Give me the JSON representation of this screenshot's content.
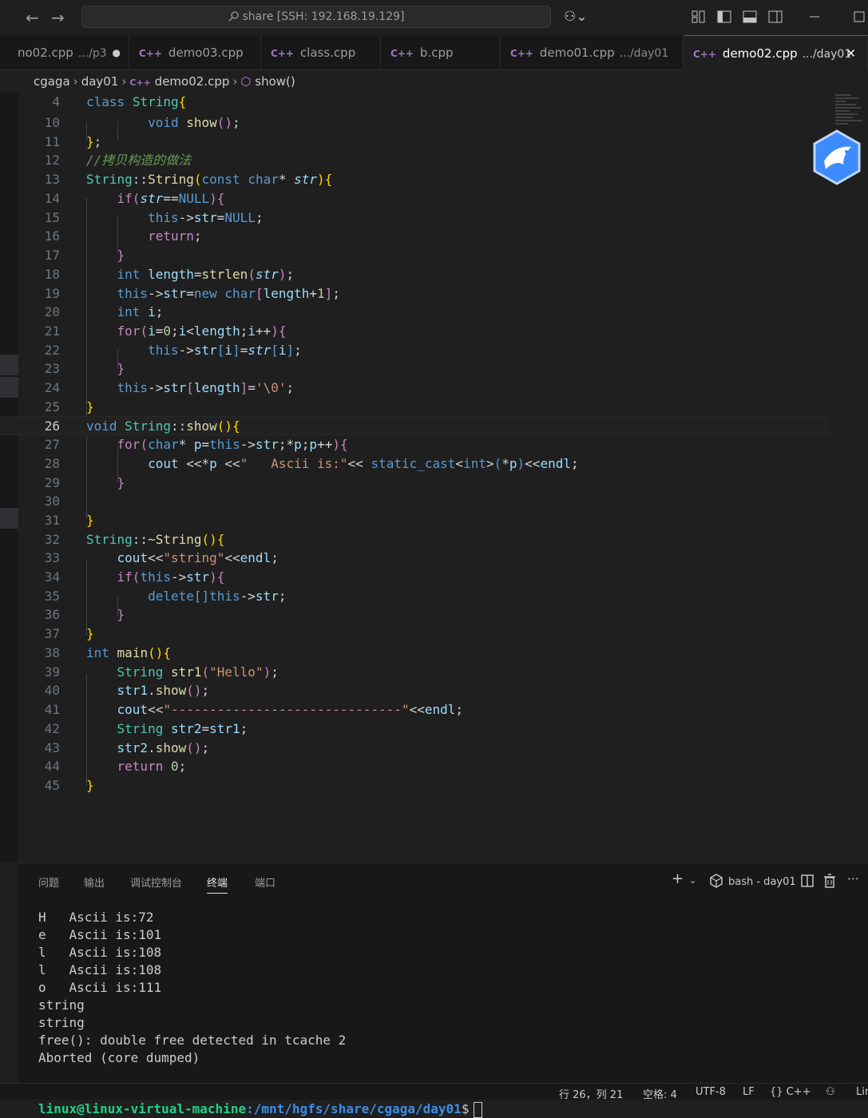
{
  "titlebar": {
    "back": "←",
    "forward": "→",
    "search": "share [SSH: 192.168.19.129]",
    "copilot": "⚇⌄"
  },
  "tabs": [
    {
      "name": "no02.cpp",
      "dir": ".../p3",
      "modified": "●"
    },
    {
      "name": "demo03.cpp",
      "dir": ""
    },
    {
      "name": "class.cpp",
      "dir": ""
    },
    {
      "name": "b.cpp",
      "dir": ""
    },
    {
      "name": "demo01.cpp",
      "dir": ".../day01"
    },
    {
      "name": "demo02.cpp",
      "dir": ".../day01",
      "close": "✕"
    }
  ],
  "breadcrumb": {
    "parts": [
      "cgaga",
      "day01",
      "demo02.cpp",
      "show()"
    ]
  },
  "editor": {
    "line_numbers": [
      "4",
      "10",
      "11",
      "12",
      "13",
      "14",
      "15",
      "16",
      "17",
      "18",
      "19",
      "20",
      "21",
      "22",
      "23",
      "24",
      "25",
      "26",
      "27",
      "28",
      "29",
      "30",
      "31",
      "32",
      "33",
      "34",
      "35",
      "36",
      "37",
      "38",
      "39",
      "40",
      "41",
      "42",
      "43",
      "44",
      "45"
    ],
    "current_line": "26"
  },
  "panel": {
    "tabs": [
      "问题",
      "输出",
      "调试控制台",
      "终端",
      "端口"
    ],
    "active_tab": "终端",
    "terminal_label": "bash - day01",
    "terminal_lines": [
      "H   Ascii is:72",
      "e   Ascii is:101",
      "l   Ascii is:108",
      "l   Ascii is:108",
      "o   Ascii is:111",
      "string",
      "string",
      "free(): double free detected in tcache 2",
      "Aborted (core dumped)"
    ],
    "prompt_user": "linux@linux-virtual-machine",
    "prompt_path": ":/mnt/hgfs/share/cgaga/day01",
    "prompt_symbol": "$"
  },
  "statusbar": {
    "position": "行 26，列 21",
    "indent": "空格: 4",
    "encoding": "UTF-8",
    "eol": "LF",
    "language": "{} C++",
    "extra": "Lin"
  }
}
